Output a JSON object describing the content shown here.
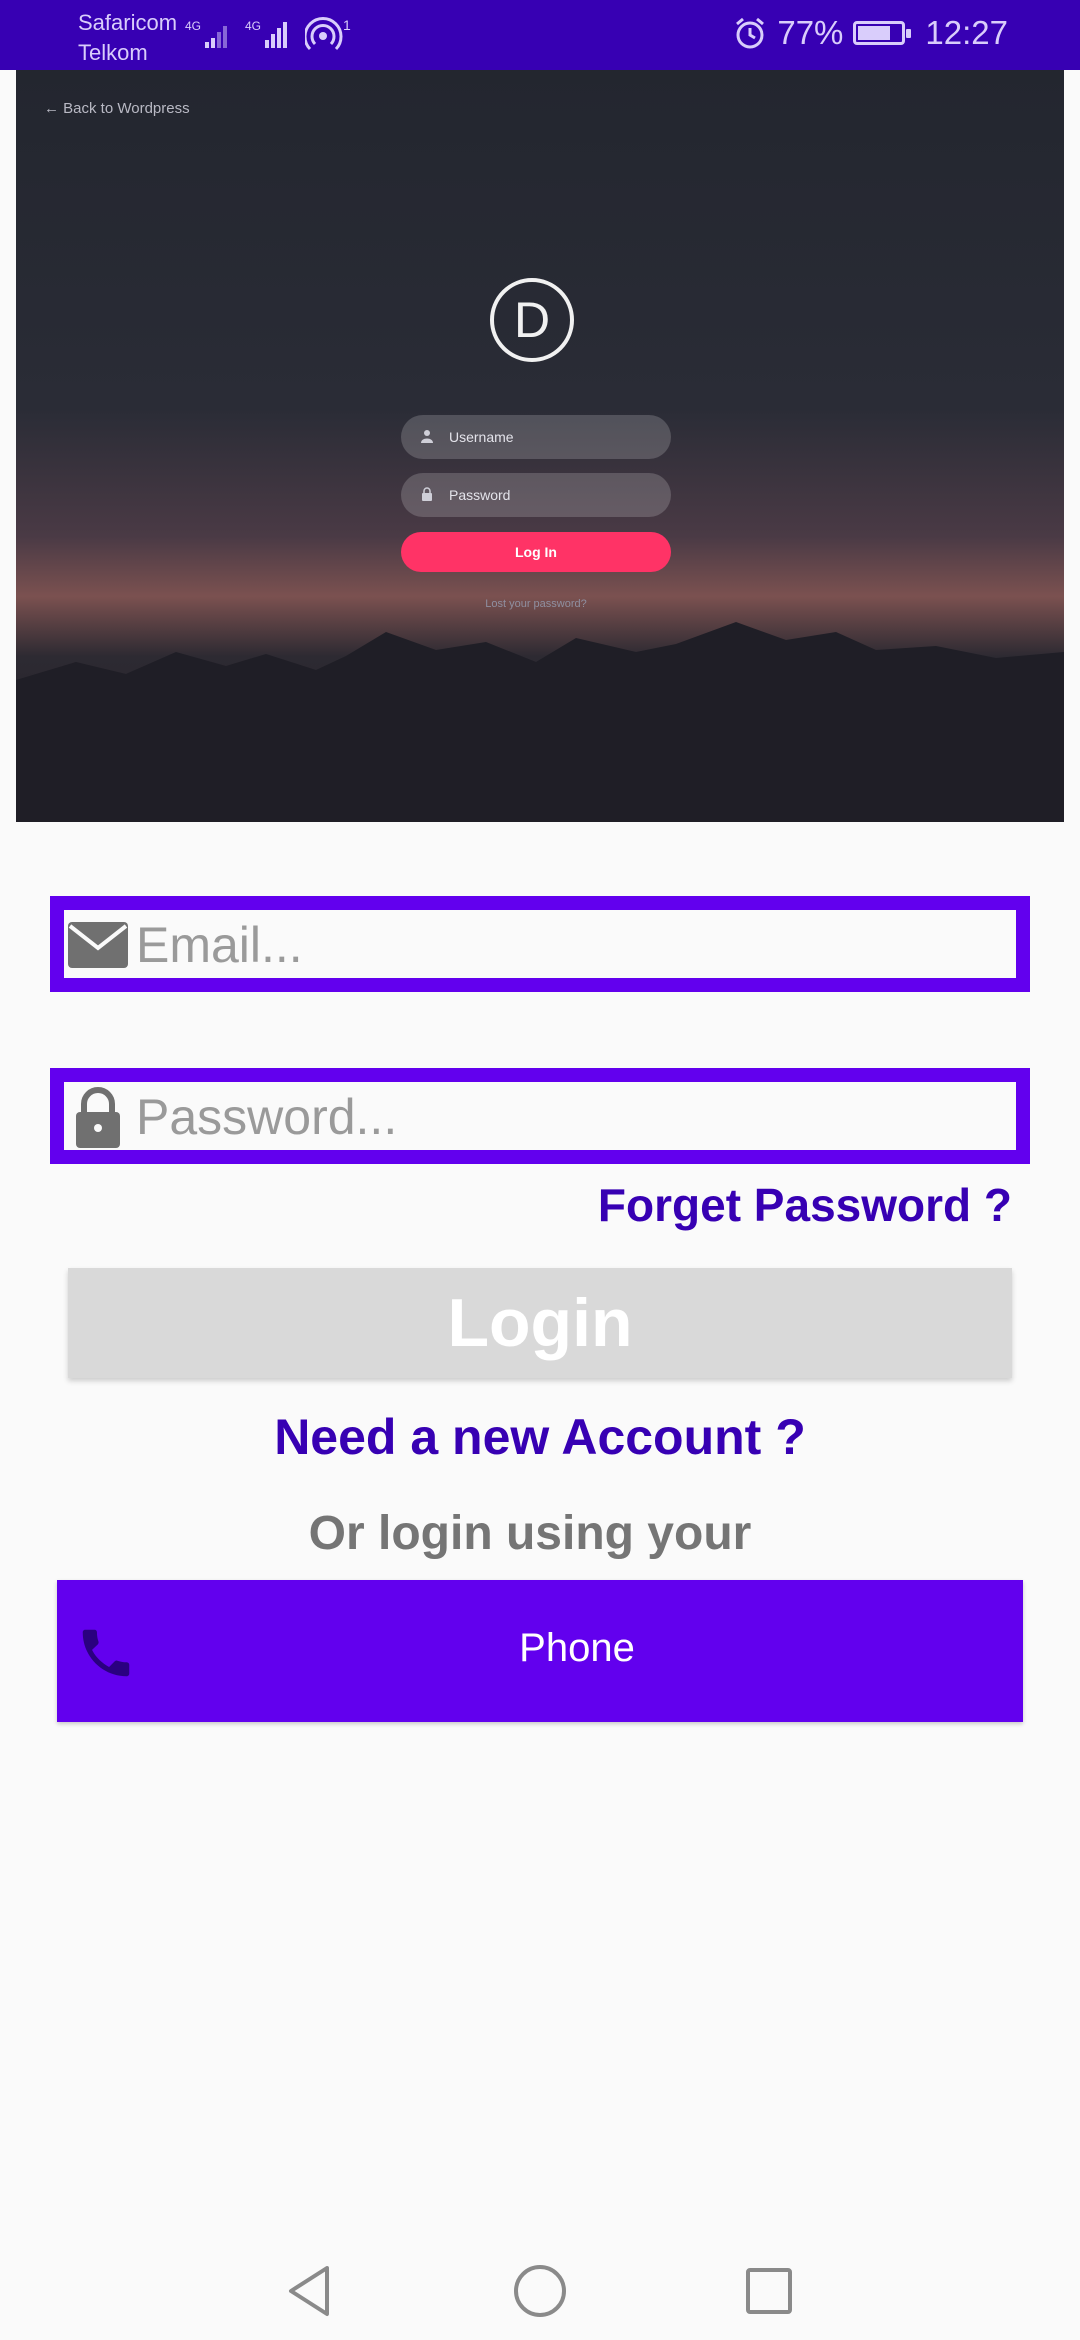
{
  "status_bar": {
    "carrier_1": "Safaricom",
    "carrier_2": "Telkom",
    "network_1": "4G",
    "network_2": "4G",
    "hotspot_count": "1",
    "battery_percent": "77%",
    "battery_level": 0.77,
    "time": "12:27"
  },
  "hero_image": {
    "back_link": "← Back to Wordpress",
    "logo_letter": "D",
    "username_placeholder": "Username",
    "password_placeholder": "Password",
    "login_label": "Log In",
    "lost_password": "Lost your password?",
    "accent_color": "#ff3366"
  },
  "form": {
    "email_placeholder": "Email...",
    "password_placeholder": "Password...",
    "forget_password": "Forget Password ?",
    "login_label": "Login",
    "new_account": "Need a new Account ?",
    "or_login": "Or login using your",
    "phone_label": "Phone"
  },
  "colors": {
    "primary": "#6200ee",
    "primary_dark": "#3700b3",
    "disabled_button": "#d9d9d9"
  },
  "icons": {
    "email": "envelope-icon",
    "password": "lock-icon",
    "phone": "phone-icon",
    "nav_back": "triangle-back-icon",
    "nav_home": "circle-home-icon",
    "nav_recents": "square-recents-icon"
  }
}
